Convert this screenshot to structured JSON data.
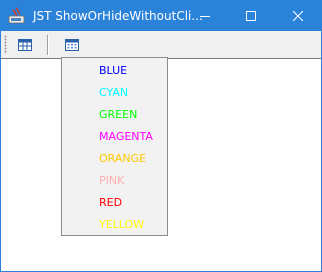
{
  "window": {
    "title": "JST ShowOrHideWithoutCli..."
  },
  "titlebar_buttons": {
    "minimize": "minimize-icon",
    "maximize": "maximize-icon",
    "close": "close-icon"
  },
  "toolbar": {
    "buttons": [
      "table-icon",
      "calendar-icon"
    ]
  },
  "menu": {
    "items": [
      {
        "label": "BLUE",
        "color": "#0000ff"
      },
      {
        "label": "CYAN",
        "color": "#00ffff"
      },
      {
        "label": "GREEN",
        "color": "#00ff00"
      },
      {
        "label": "MAGENTA",
        "color": "#ff00ff"
      },
      {
        "label": "ORANGE",
        "color": "#ffc800"
      },
      {
        "label": "PINK",
        "color": "#ffafaf"
      },
      {
        "label": "RED",
        "color": "#ff0000"
      },
      {
        "label": "YELLOW",
        "color": "#ffff00"
      }
    ]
  }
}
